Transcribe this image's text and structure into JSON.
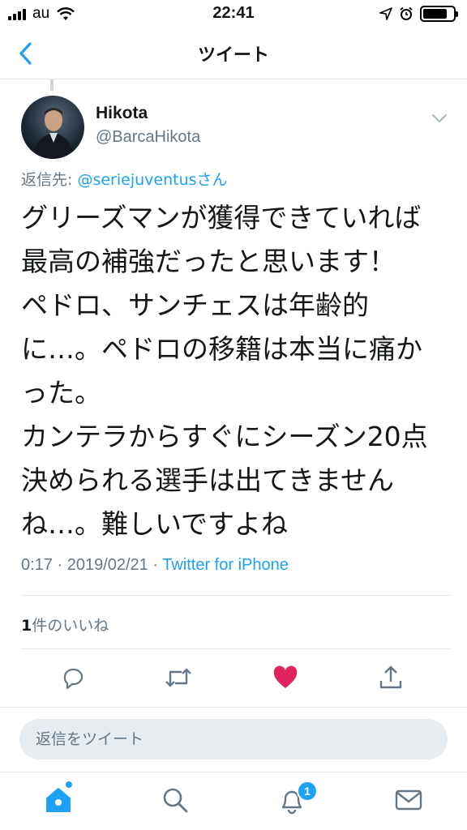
{
  "status_bar": {
    "carrier": "au",
    "time": "22:41",
    "battery_level": 0.8
  },
  "nav": {
    "title": "ツイート",
    "back_icon": "chevron-left-icon"
  },
  "tweet": {
    "display_name": "Hikota",
    "handle": "@BarcaHikota",
    "reply_prefix": "返信先: ",
    "reply_mention": "@seriejuventus",
    "reply_suffix": "さん",
    "text": "グリーズマンが獲得できていれば\n最高の補強だったと思います！\nペドロ、サンチェスは年齢的\nに…。ペドロの移籍は本当に痛か\nった。\nカンテラからすぐにシーズン20点\n決められる選手は出てきません\nね…。難しいですよね",
    "timestamp": "0:17 · 2019/02/21 · ",
    "source": "Twitter for iPhone",
    "like_count": "1",
    "like_label": "件のいいね",
    "liked": true
  },
  "composer": {
    "placeholder": "返信をツイート"
  },
  "tab_bar": {
    "notification_badge": "1"
  },
  "colors": {
    "accent": "#1da1f2",
    "like": "#e0245e",
    "secondary_text": "#657786",
    "divider": "#e1e8ed"
  }
}
